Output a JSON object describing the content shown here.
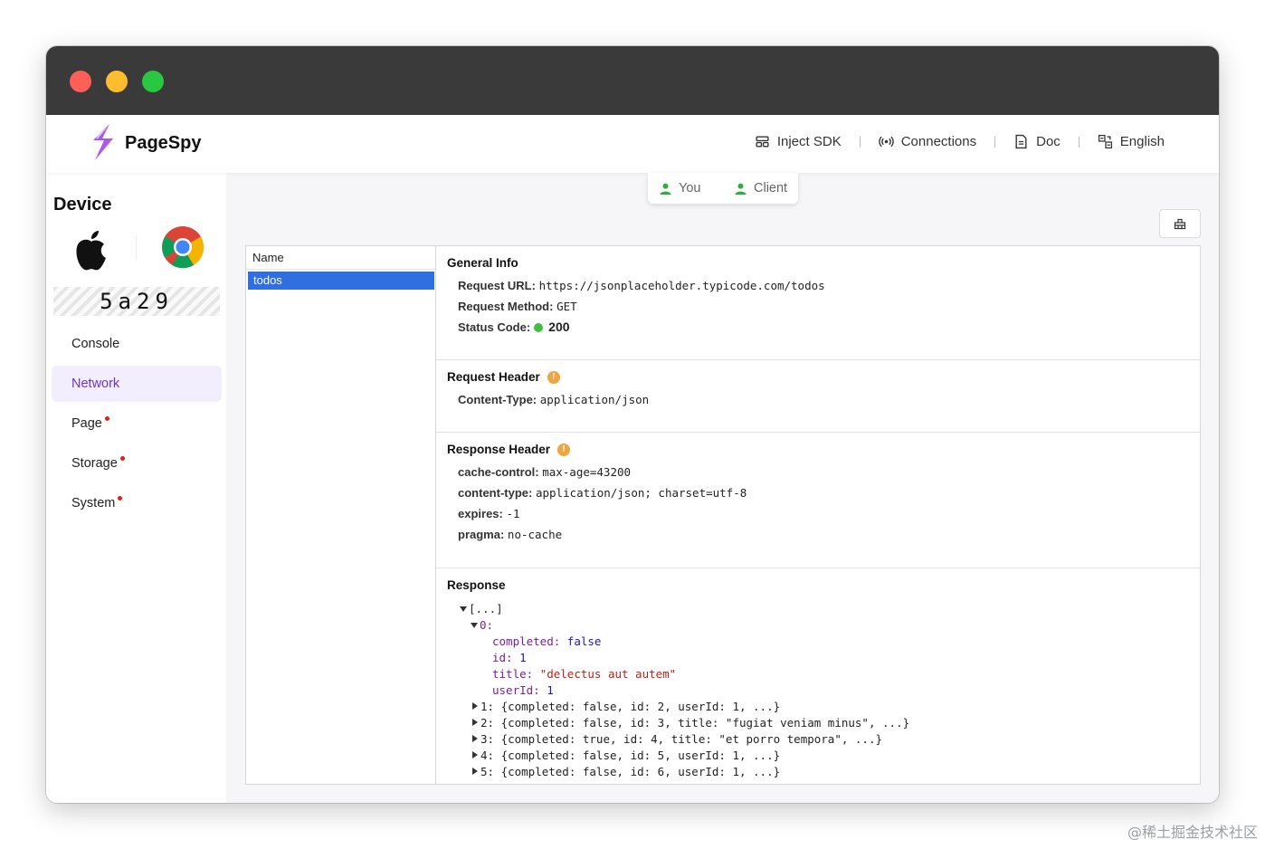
{
  "header": {
    "brand": "PageSpy",
    "nav": {
      "inject_sdk": "Inject SDK",
      "connections": "Connections",
      "doc": "Doc",
      "language": "English"
    }
  },
  "sidebar": {
    "title": "Device",
    "device_code": "5a29",
    "items": [
      {
        "label": "Console"
      },
      {
        "label": "Network"
      },
      {
        "label": "Page"
      },
      {
        "label": "Storage"
      },
      {
        "label": "System"
      }
    ]
  },
  "toggle": {
    "you": "You",
    "client": "Client"
  },
  "network": {
    "list_header": "Name",
    "selected_row": "todos",
    "general": {
      "title": "General Info",
      "url_label": "Request URL:",
      "url": "https://jsonplaceholder.typicode.com/todos",
      "method_label": "Request Method:",
      "method": "GET",
      "status_label": "Status Code:",
      "status": "200"
    },
    "request_header": {
      "title": "Request Header",
      "content_type_label": "Content-Type:",
      "content_type": "application/json"
    },
    "response_header": {
      "title": "Response Header",
      "cache_control_label": "cache-control:",
      "cache_control": "max-age=43200",
      "content_type_label": "content-type:",
      "content_type": "application/json; charset=utf-8",
      "expires_label": "expires:",
      "expires": "-1",
      "pragma_label": "pragma:",
      "pragma": "no-cache"
    },
    "response": {
      "title": "Response",
      "root": "[...]",
      "item0_key": "0:",
      "completed_key": "completed:",
      "completed_val": "false",
      "id_key": "id:",
      "id_val": "1",
      "title_key": "title:",
      "title_val": "\"delectus aut autem\"",
      "userid_key": "userId:",
      "userid_val": "1",
      "collapsed": [
        "1: {completed: false, id: 2, userId: 1, ...}",
        "2: {completed: false, id: 3, title: \"fugiat veniam minus\", ...}",
        "3: {completed: true, id: 4, title: \"et porro tempora\", ...}",
        "4: {completed: false, id: 5, userId: 1, ...}",
        "5: {completed: false, id: 6, userId: 1, ...}"
      ]
    }
  },
  "watermark": "@稀土掘金技术社区",
  "colors": {
    "accent": "#6c35c9",
    "selected_row": "#2f6fe0",
    "status_ok": "#3fbf3f",
    "info": "#f0a543"
  }
}
